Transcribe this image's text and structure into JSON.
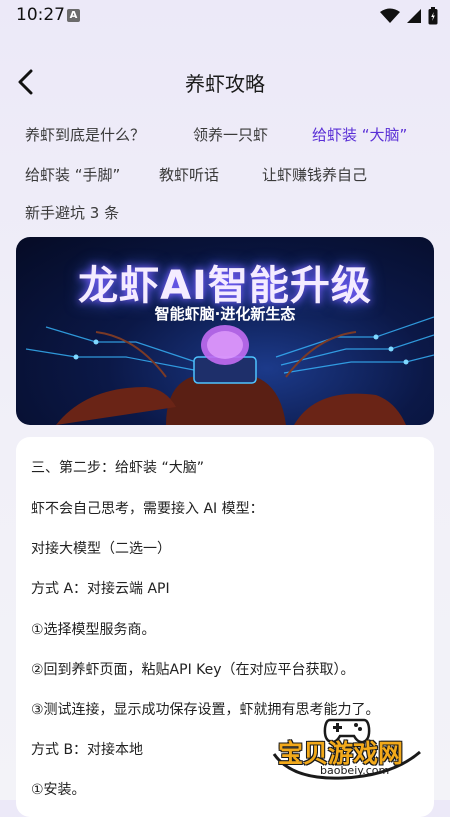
{
  "status_bar": {
    "time": "10:27",
    "notification_icon_letter": "A"
  },
  "header": {
    "title": "养虾攻略"
  },
  "tabs": [
    {
      "label": "养虾到底是什么？",
      "active": false
    },
    {
      "label": "领养一只虾",
      "active": false
    },
    {
      "label": "给虾装 “大脑”",
      "active": true
    },
    {
      "label": "给虾装 “手脚”",
      "active": false
    },
    {
      "label": "教虾听话",
      "active": false
    },
    {
      "label": "让虾赚钱养自己",
      "active": false
    },
    {
      "label": "新手避坑 3 条",
      "active": false
    }
  ],
  "banner": {
    "title": "龙虾AI智能升级",
    "subtitle": "智能虾脑·进化新生态"
  },
  "content": {
    "lines": [
      "三、第二步：给虾装 “大脑”",
      "虾不会自己思考，需要接入 AI 模型：",
      "对接大模型（二选一）",
      "方式 A：对接云端 API",
      "①选择模型服务商。",
      "②回到养虾页面，粘贴API Key（在对应平台获取）。",
      "③测试连接，显示成功保存设置，虾就拥有思考能力了。",
      "方式 B：对接本地",
      "①安装。"
    ]
  },
  "watermark": {
    "title": "宝贝游戏网",
    "url": "baobeiy.com"
  },
  "colors": {
    "accent": "#5a2fd6",
    "background": "#efedf7",
    "banner_bg": "#0b1847"
  }
}
